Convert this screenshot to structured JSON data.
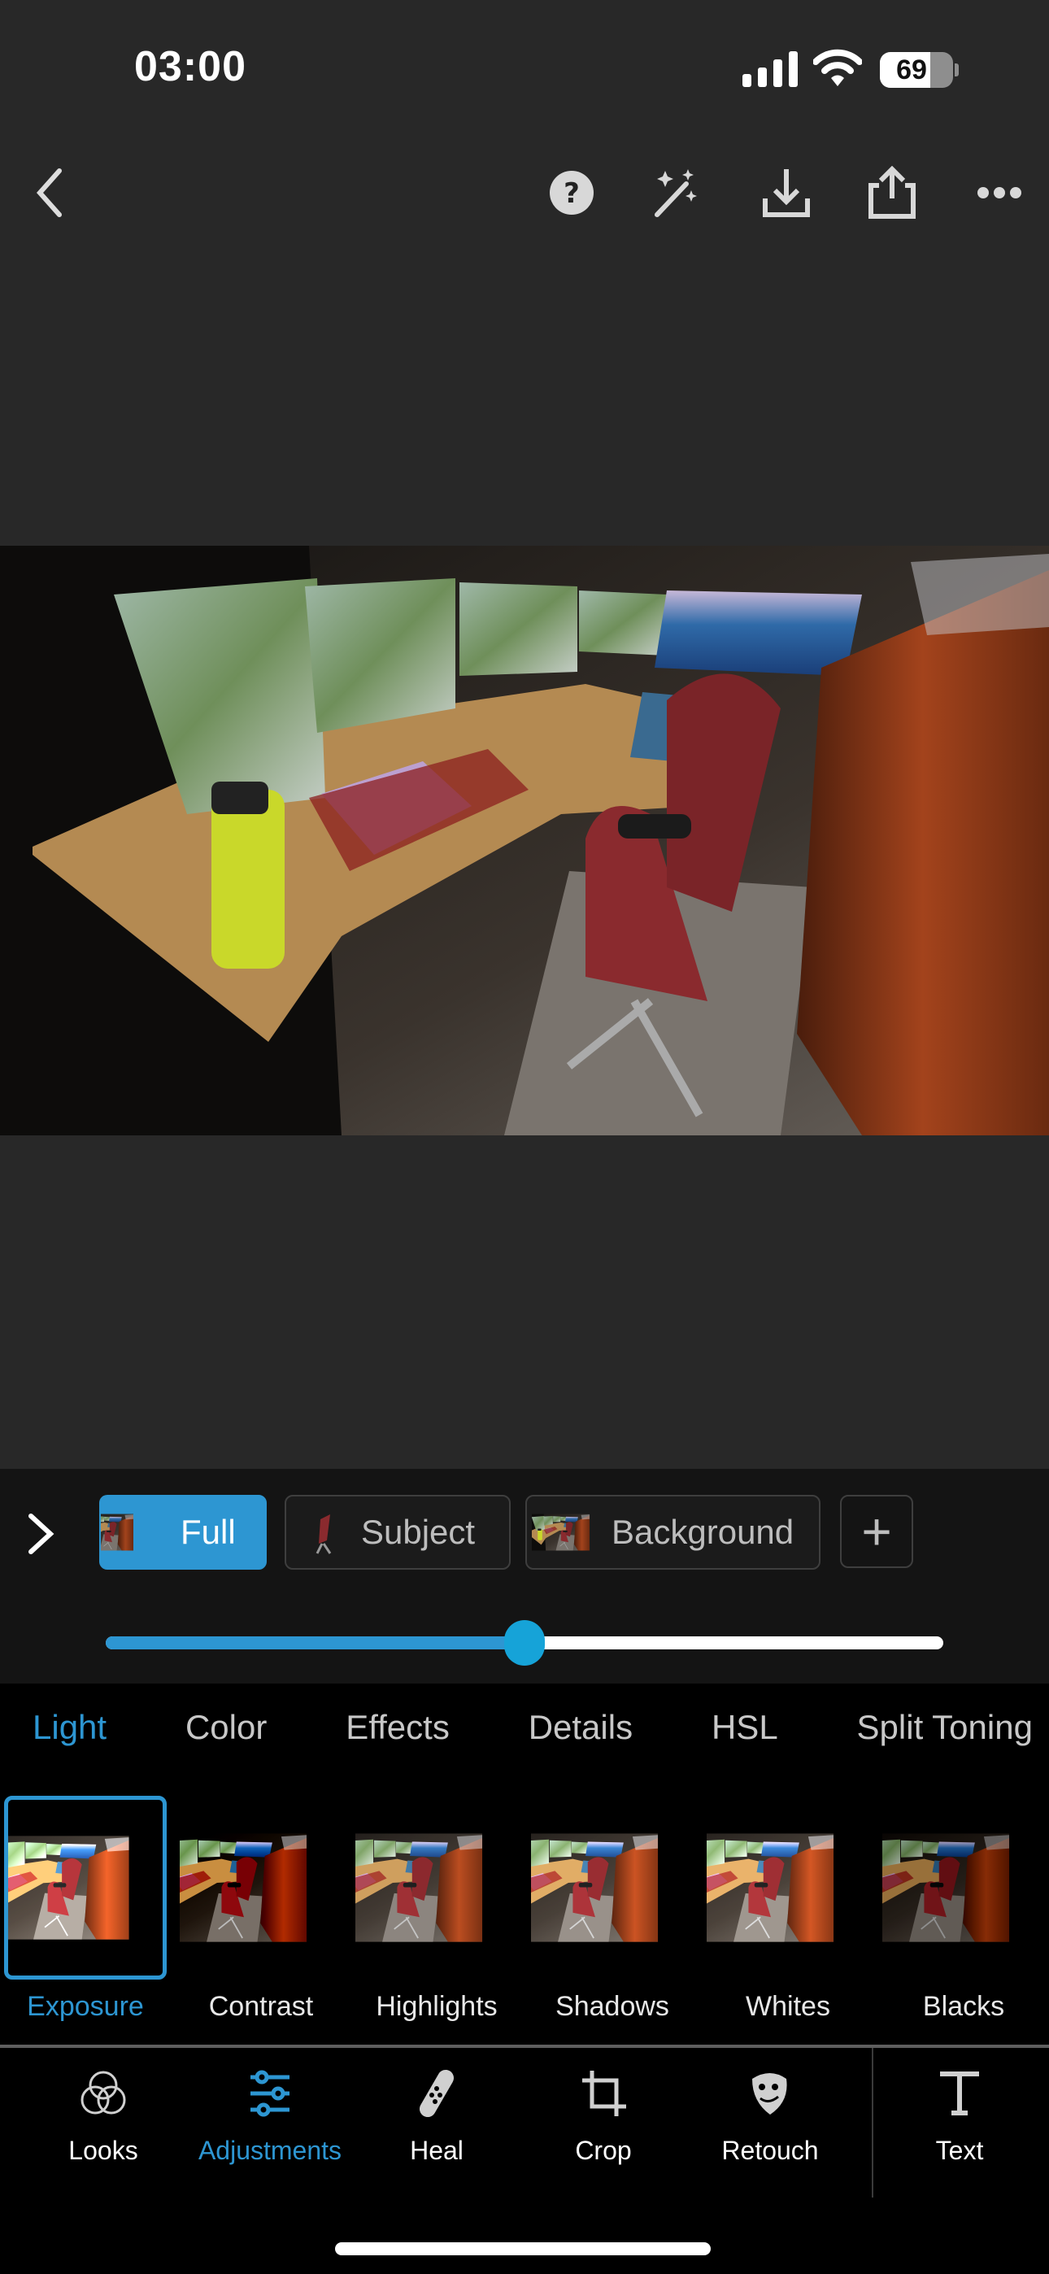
{
  "status_bar": {
    "time": "03:00",
    "battery": "69",
    "battery_level": 0.69
  },
  "toolbar": {
    "icons": [
      "back-chevron-icon",
      "help-icon",
      "magic-wand-icon",
      "download-icon",
      "share-icon",
      "more-icon"
    ]
  },
  "masks": {
    "items": [
      {
        "label": "Full",
        "active": true
      },
      {
        "label": "Subject",
        "active": false
      },
      {
        "label": "Background",
        "active": false
      }
    ],
    "add_label": "+"
  },
  "slider": {
    "value": 0.5
  },
  "tabs": [
    {
      "label": "Light",
      "active": true
    },
    {
      "label": "Color"
    },
    {
      "label": "Effects"
    },
    {
      "label": "Details"
    },
    {
      "label": "HSL"
    },
    {
      "label": "Split Toning"
    }
  ],
  "tools": [
    {
      "label": "Exposure",
      "active": true
    },
    {
      "label": "Contrast"
    },
    {
      "label": "Highlights"
    },
    {
      "label": "Shadows"
    },
    {
      "label": "Whites"
    },
    {
      "label": "Blacks"
    }
  ],
  "bottom_nav": [
    {
      "label": "Looks",
      "icon": "looks-circles-icon"
    },
    {
      "label": "Adjustments",
      "icon": "sliders-icon",
      "active": true
    },
    {
      "label": "Heal",
      "icon": "bandage-icon"
    },
    {
      "label": "Crop",
      "icon": "crop-icon"
    },
    {
      "label": "Retouch",
      "icon": "retouch-mask-icon"
    },
    {
      "label": "Text",
      "icon": "text-icon"
    }
  ],
  "colors": {
    "accent": "#2d96d2",
    "background": "#282828",
    "panel": "#141414"
  }
}
